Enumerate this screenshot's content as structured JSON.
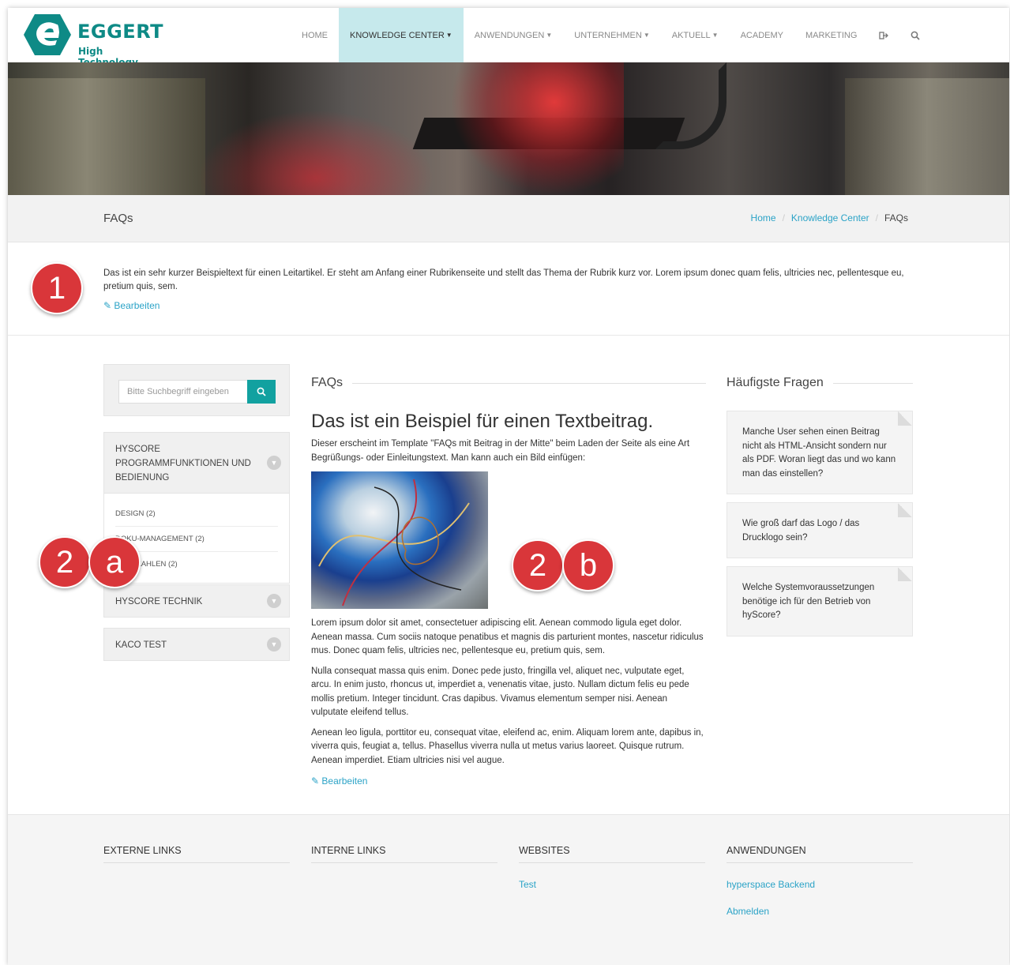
{
  "brand": {
    "name": "EGGERT",
    "tagline": "High Technology",
    "color": "#0e8a86"
  },
  "nav": {
    "items": [
      {
        "label": "HOME"
      },
      {
        "label": "KNOWLEDGE CENTER"
      },
      {
        "label": "ANWENDUNGEN"
      },
      {
        "label": "UNTERNEHMEN"
      },
      {
        "label": "AKTUELL"
      },
      {
        "label": "ACADEMY"
      },
      {
        "label": "MARKETING"
      }
    ],
    "icons": [
      "logout-icon",
      "search-icon"
    ],
    "active_color": "#c6e9ec"
  },
  "page": {
    "title": "FAQs",
    "breadcrumb": [
      "Home",
      "Knowledge Center",
      "FAQs"
    ]
  },
  "intro": {
    "text": "Das ist ein sehr kurzer Beispieltext für einen Leitartikel. Er steht am Anfang einer Rubrikenseite und stellt das Thema der Rubrik kurz vor. Lorem ipsum donec quam felis, ultricies nec, pellentesque eu, pretium quis, sem.",
    "edit_label": "Bearbeiten"
  },
  "annotations": {
    "badge1": "1",
    "badge2a_num": "2",
    "badge2a_letter": "a",
    "badge2b_num": "2",
    "badge2b_letter": "b",
    "color": "#d9363a"
  },
  "sidebar": {
    "search_placeholder": "Bitte Suchbegriff eingeben",
    "groups": [
      {
        "label": "HYSCORE PROGRAMMFUNKTIONEN UND BEDIENUNG",
        "subs": [
          "DESIGN (2)",
          "DOKU-MANAGEMENT (2)",
          "LIZENZAHLEN (2)"
        ]
      },
      {
        "label": "HYSCORE TECHNIK"
      },
      {
        "label": "KACO TEST"
      }
    ]
  },
  "main": {
    "section_title": "FAQs",
    "heading": "Das ist ein Beispiel für einen Textbeitrag.",
    "lead": "Dieser erscheint im Template \"FAQs mit Beitrag in der Mitte\" beim Laden der Seite als eine Art Begrüßungs- oder Einleitungstext. Man kann auch ein Bild einfügen:",
    "paragraphs": [
      "Lorem ipsum dolor sit amet, consectetuer adipiscing elit. Aenean commodo ligula eget dolor. Aenean massa. Cum sociis natoque penatibus et magnis dis parturient montes, nascetur ridiculus mus. Donec quam felis, ultricies nec, pellentesque eu, pretium quis, sem.",
      "Nulla consequat massa quis enim. Donec pede justo, fringilla vel, aliquet nec, vulputate eget, arcu. In enim justo, rhoncus ut, imperdiet a, venenatis vitae, justo. Nullam dictum felis eu pede mollis pretium. Integer tincidunt. Cras dapibus. Vivamus elementum semper nisi. Aenean vulputate eleifend tellus.",
      "Aenean leo ligula, porttitor eu, consequat vitae, eleifend ac, enim. Aliquam lorem ante, dapibus in, viverra quis, feugiat a, tellus. Phasellus viverra nulla ut metus varius laoreet. Quisque rutrum. Aenean imperdiet. Etiam ultricies nisi vel augue."
    ],
    "edit_label": "Bearbeiten"
  },
  "right": {
    "title": "Häufigste Fragen",
    "questions": [
      "Manche User sehen einen Beitrag nicht als HTML-Ansicht sondern nur als PDF. Woran liegt das und wo kann man das einstellen?",
      "Wie groß darf das Logo / das Drucklogo sein?",
      "Welche Systemvoraussetzungen benötige ich für den Betrieb von hyScore?"
    ]
  },
  "footer": {
    "cols": [
      {
        "title": "EXTERNE LINKS",
        "links": []
      },
      {
        "title": "INTERNE LINKS",
        "links": []
      },
      {
        "title": "WEBSITES",
        "links": [
          "Test"
        ]
      },
      {
        "title": "ANWENDUNGEN",
        "links": [
          "hyperspace Backend",
          "Abmelden"
        ]
      }
    ]
  },
  "accent_link_color": "#2ba3c7",
  "button_color": "#12a1a0"
}
